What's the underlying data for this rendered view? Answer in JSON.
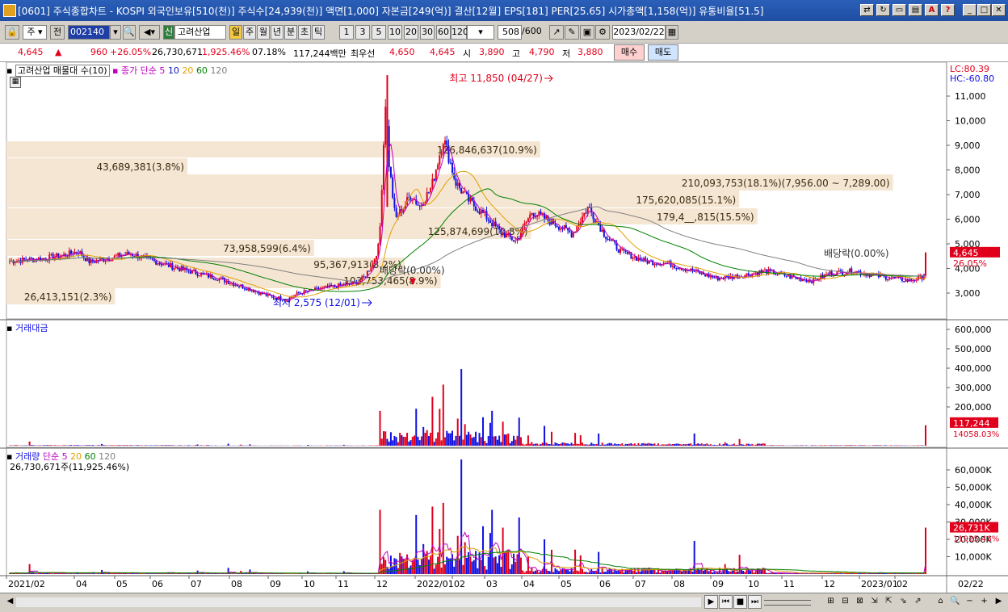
{
  "window": {
    "title": "[0601] 주식종합차트 - KOSPI 외국인보유[510(천)] 주식수[24,939(천)] 액면[1,000] 자본금[249(억)] 결산[12월] EPS[181] PER[25.65] 시가총액[1,158(억)] 유통비율[51.5]"
  },
  "toolbar": {
    "period_select": "주",
    "prev_label": "전",
    "code": "002140",
    "sin_label": "신",
    "stock_name": "고려산업",
    "period_buttons": [
      "일",
      "주",
      "월",
      "년",
      "분",
      "초",
      "틱"
    ],
    "num_buttons": [
      "1",
      "3",
      "5",
      "10",
      "20",
      "30",
      "60",
      "120"
    ],
    "count": "508",
    "count_total": "/600",
    "date": "2023/02/22"
  },
  "info": {
    "price": "4,645",
    "change": "960",
    "change_pct": "+26.05%",
    "volume": "26,730,671",
    "volume_pct": "1,925.46%",
    "turnover": "07.18%",
    "amount": "117,244백만",
    "best_ask_label": "최우선",
    "best_ask": "4,650",
    "best_bid": "4,645",
    "open_label": "시",
    "open": "3,890",
    "high_label": "고",
    "high": "4,790",
    "low_label": "저",
    "low": "3,880",
    "buy_button": "매수",
    "sell_button": "매도"
  },
  "price_pane": {
    "header_name": "고려산업 매물대 수(10)",
    "ma_label": "종가 단순 5",
    "ma_periods": [
      "10",
      "20",
      "60",
      "120"
    ],
    "lc": "LC:80.39",
    "hc": "HC:-60.80",
    "y_ticks": [
      "11,000",
      "10,000",
      "9,000",
      "8,000",
      "7,000",
      "6,000",
      "5,000",
      "4,000",
      "3,000"
    ],
    "price_tag": "4,645",
    "pct_tag": "26.05%",
    "high_annotation": "최고 11,850 (04/27)",
    "low_annotation": "최저 2,575 (12/01)",
    "dividend_labels": [
      "배당락(0.00%)",
      "배당락(0.00%)"
    ],
    "volume_profile": [
      {
        "label": "210,093,753(18.1%)(7,956.00 ~ 7,289.00)",
        "frac": 0.98
      },
      {
        "label": "179,4__,815(15.5%)",
        "frac": 0.83
      },
      {
        "label": "175,620,085(15.1%)",
        "frac": 0.81
      },
      {
        "label": "126,846,637(10.9%)",
        "frac": 0.59
      },
      {
        "label": "125,874,699(10.8%)",
        "frac": 0.58
      },
      {
        "label": "103,753,465(8.9%)",
        "frac": 0.48
      },
      {
        "label": "95,367,913(8.2%)",
        "frac": 0.44
      },
      {
        "label": "73,958,599(6.4%)",
        "frac": 0.34
      },
      {
        "label": "43,689,381(3.8%)",
        "frac": 0.2
      },
      {
        "label": "26,413,151(2.3%)",
        "frac": 0.12
      }
    ]
  },
  "amount_pane": {
    "title": "거래대금",
    "y_ticks": [
      "600,000",
      "500,000",
      "400,000",
      "300,000",
      "200,000"
    ],
    "tag": "117,244",
    "tag2": "14058.03%"
  },
  "volume_pane": {
    "title": "거래량",
    "ma_label": "단순 5",
    "ma_periods": [
      "20",
      "60",
      "120"
    ],
    "subtitle": "26,730,671주(11,925.46%)",
    "y_ticks": [
      "60,000K",
      "50,000K",
      "40,000K",
      "30,000K",
      "20,000K",
      "10,000K"
    ],
    "tag": "26,731K",
    "tag2": "11925.46%"
  },
  "x_axis": [
    "2021/02",
    "04",
    "05",
    "06",
    "07",
    "08",
    "09",
    "10",
    "11",
    "12",
    "2022/01",
    "02",
    "03",
    "04",
    "05",
    "06",
    "07",
    "08",
    "09",
    "10",
    "11",
    "12",
    "2023/01",
    "02"
  ],
  "x_axis_end": "02/22",
  "colors": {
    "up": "#e0001c",
    "down": "#1010e0",
    "ma5": "#c000c0",
    "ma10": "#1010c0",
    "ma20": "#e0a000",
    "ma60": "#008000",
    "ma120": "#808080",
    "profile": "#f5e6d3"
  }
}
